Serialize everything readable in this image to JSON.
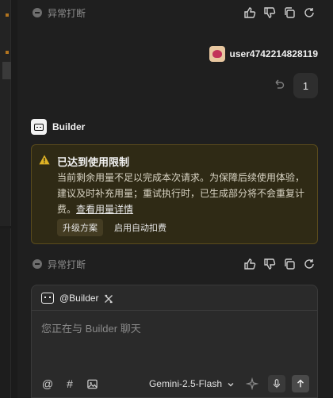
{
  "status_top": {
    "text": "异常打断"
  },
  "status_bottom": {
    "text": "异常打断"
  },
  "user_message": {
    "username": "user4742214828119",
    "content": "1"
  },
  "assistant": {
    "name": "Builder"
  },
  "limit_card": {
    "title": "已达到使用限制",
    "body": "当前剩余用量不足以完成本次请求。为保障后续使用体验，建议及时补充用量；重试执行时，已生成部分将不会重复计费。",
    "link": "查看用量详情",
    "primary_button": "升级方案",
    "secondary_button": "启用自动扣费",
    "accent_color": "#e0b325"
  },
  "composer": {
    "agent": "@Builder",
    "placeholder": "您正在与 Builder 聊天",
    "model": "Gemini-2.5-Flash",
    "tools": {
      "mention": "@",
      "hashtag": "#"
    }
  }
}
